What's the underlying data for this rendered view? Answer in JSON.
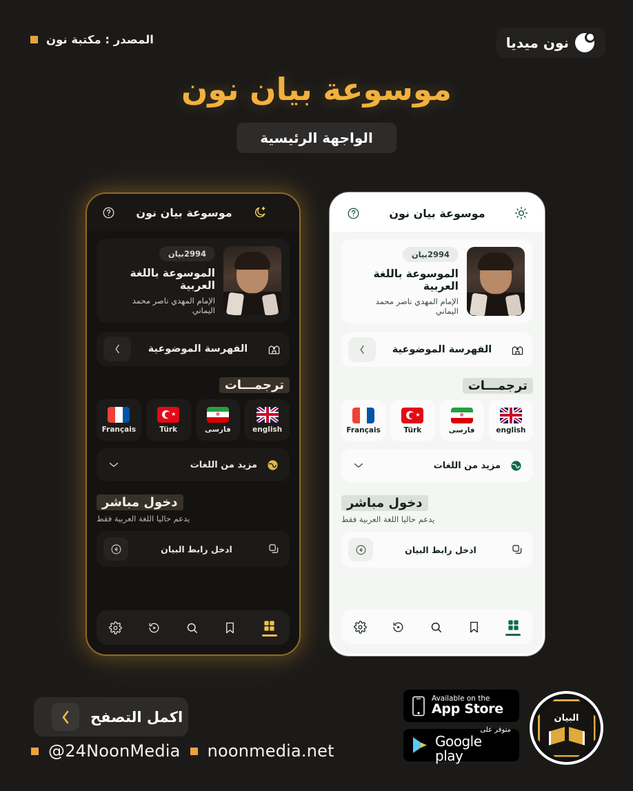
{
  "brand": {
    "name": "نون ميديا",
    "logo_icon": "moon-logo-icon",
    "source_label": "المصدر : مكتبة نون"
  },
  "hero": {
    "title": "موسوعة بيان نون",
    "badge": "الواجهة الرئيسية"
  },
  "app": {
    "header": {
      "title": "موسوعة بيان نون",
      "theme_toggle_dark": "moon-star-icon",
      "theme_toggle_light": "sun-icon",
      "help_icon": "question-mark-circle-icon"
    },
    "profile_card": {
      "count_badge": "2994بيان",
      "line1": "الموسوعة باللغة العربية",
      "line2": "الإمام المهدي ناصر محمد اليماني",
      "avatar_name": "avatar"
    },
    "index_row": {
      "label": "الفهرسة الموضوعية",
      "icon": "index-book-icon",
      "chevron": "chevron-left-icon"
    },
    "translations": {
      "heading": "ترجمـــات",
      "languages": [
        {
          "name": "Français",
          "flag": "flag-france-icon"
        },
        {
          "name": "Türk",
          "flag": "flag-turkey-icon"
        },
        {
          "name": "فارسى",
          "flag": "flag-iran-icon"
        },
        {
          "name": "english",
          "flag": "flag-uk-icon"
        }
      ],
      "more_label": "مزيد من اللغات",
      "more_icon": "globe-icon",
      "more_chevron": "chevron-down-icon"
    },
    "direct_entry": {
      "heading": "دخول مباشر",
      "subtitle": "يدعم حاليا اللغة العربية فقط",
      "link_label": "ادخل رابط البيان",
      "link_icon": "copy-link-icon",
      "go_icon": "arrow-left-circle-icon"
    },
    "bottom_nav": [
      {
        "name": "settings",
        "icon": "gear-icon",
        "active": false
      },
      {
        "name": "history",
        "icon": "history-play-icon",
        "active": false
      },
      {
        "name": "search",
        "icon": "search-icon",
        "active": false
      },
      {
        "name": "bookmarks",
        "icon": "bookmark-icon",
        "active": false
      },
      {
        "name": "grid",
        "icon": "grid-icon",
        "active": true
      }
    ]
  },
  "footer": {
    "browse_button": "اكمل التصفح",
    "browse_chevron": "chevron-left-icon",
    "handle": "@24NoonMedia",
    "website": "noonmedia.net",
    "appstore": {
      "line1": "Available on the",
      "line2": "App Store"
    },
    "googleplay": {
      "line1": "متوفر على",
      "line2": "Google play"
    },
    "circle_logo_text": "البيان"
  },
  "colors": {
    "gold": "#f2b13c",
    "orange_square": "#e8a33d",
    "dark_bg": "#1b1a19",
    "green_accent": "#0d6b4f"
  }
}
